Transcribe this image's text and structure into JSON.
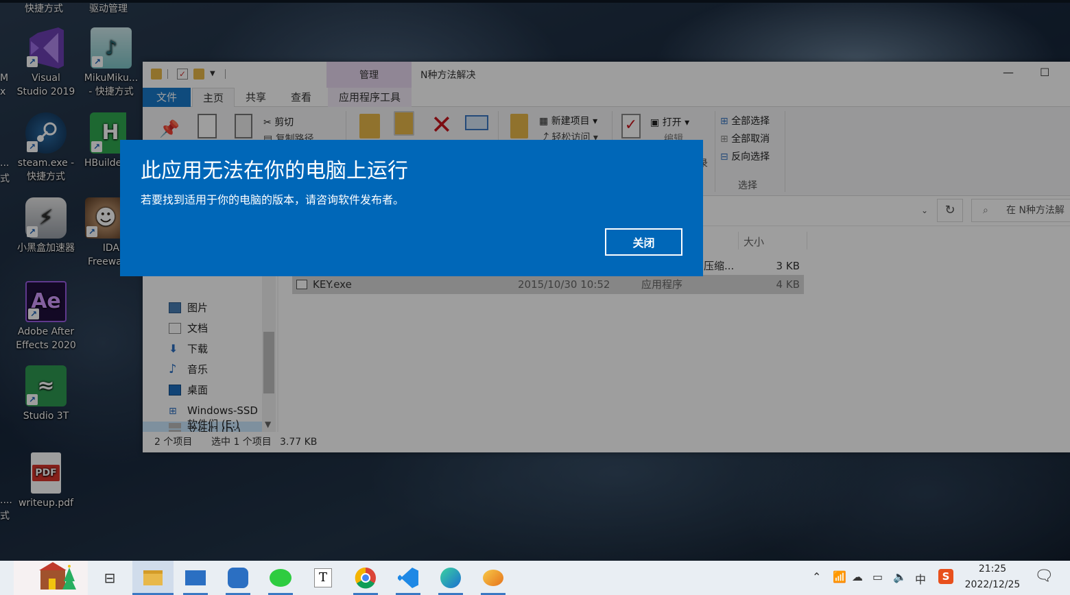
{
  "desktop": {
    "top_labels": [
      "快捷方式",
      "驱动管理"
    ],
    "edge_texts": [
      "M",
      "x",
      "...",
      "式",
      "....",
      "式"
    ],
    "icons": [
      {
        "name": "visual-studio",
        "label_line1": "Visual",
        "label_line2": "Studio 2019",
        "glyph": "VS",
        "color": "#6d3fb4"
      },
      {
        "name": "mikumiku",
        "label_line1": "MikuMiku...",
        "label_line2": "- 快捷方式",
        "glyph": "♪",
        "color": "#7fc6c8"
      },
      {
        "name": "steam",
        "label_line1": "steam.exe -",
        "label_line2": "快捷方式",
        "glyph": "⚙",
        "color": "#1b3a5c"
      },
      {
        "name": "hbuilder",
        "label_line1": "HBuilde",
        "label_line2": "",
        "glyph": "H",
        "color": "#2fa84f"
      },
      {
        "name": "xiaoheihe",
        "label_line1": "小黑盒加速器",
        "label_line2": "",
        "glyph": "⚡",
        "color": "#4a4f58"
      },
      {
        "name": "ida",
        "label_line1": "IDA",
        "label_line2": "Freewa",
        "glyph": "☻",
        "color": "#7a5a3a"
      },
      {
        "name": "after-effects",
        "label_line1": "Adobe After",
        "label_line2": "Effects 2020",
        "glyph": "Ae",
        "color": "#1f0f3d"
      },
      {
        "name": "studio3t",
        "label_line1": "Studio 3T",
        "label_line2": "",
        "glyph": "≈",
        "color": "#2e9a52"
      },
      {
        "name": "writeup-pdf",
        "label_line1": "writeup.pdf",
        "label_line2": "",
        "glyph": "PDF",
        "color": "#d9342b"
      }
    ]
  },
  "explorer": {
    "title": "N种方法解决",
    "manage_tab": "管理",
    "tabs": [
      "文件",
      "主页",
      "共享",
      "查看",
      "应用程序工具"
    ],
    "ribbon": {
      "cut": "剪切",
      "copy_path": "复制路径",
      "new_item": "新建项目 ▾",
      "easy_access": "轻松访问 ▾",
      "open": "打开 ▾",
      "edit": "编辑",
      "history_partial": "录",
      "select_all": "全部选择",
      "select_none": "全部取消",
      "invert_selection": "反向选择",
      "group_select": "选择"
    },
    "search_placeholder": "在 N种方法解",
    "columns": {
      "size": "大小"
    },
    "nav": [
      "图片",
      "文档",
      "下载",
      "音乐",
      "桌面",
      "Windows-SSD (",
      "文件们 (D:)",
      "软件们 (E:)"
    ],
    "files": [
      {
        "name": "",
        "date": "",
        "type": "压缩...",
        "size": "3 KB"
      },
      {
        "name": "KEY.exe",
        "date": "2015/10/30 10:52",
        "type": "应用程序",
        "size": "4 KB"
      }
    ],
    "status": {
      "count": "2 个项目",
      "selected": "选中 1 个项目",
      "size": "3.77 KB"
    }
  },
  "dialog": {
    "title": "此应用无法在你的电脑上运行",
    "message": "若要找到适用于你的电脑的版本，请咨询软件发布者。",
    "close_label": "关闭"
  },
  "taskbar": {
    "ime": "中",
    "time": "21:25",
    "date": "2022/12/25"
  },
  "colors": {
    "dialog_bg": "#0067b8",
    "file_tab": "#1979ca",
    "manage_tab": "#e8d9f0",
    "selection": "#cce8ff"
  }
}
